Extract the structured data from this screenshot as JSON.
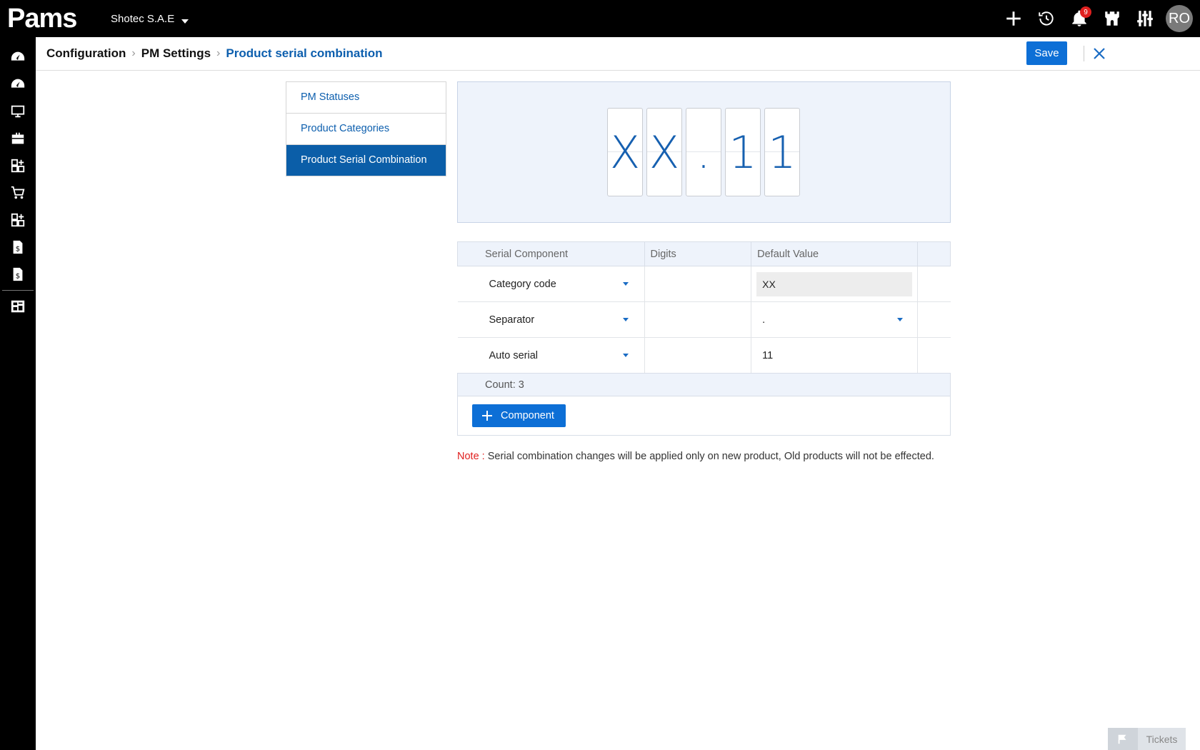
{
  "app": {
    "logo_text": "Pams",
    "company": "Shotec S.A.E",
    "notifications_count": "9",
    "user_initials": "RO"
  },
  "breadcrumb": [
    "Configuration",
    "PM Settings",
    "Product serial combination"
  ],
  "actions": {
    "save_label": "Save"
  },
  "settings_menu": [
    {
      "label": "PM Statuses",
      "active": false
    },
    {
      "label": "Product Categories",
      "active": false
    },
    {
      "label": "Product Serial Combination",
      "active": true
    }
  ],
  "preview": {
    "chars": [
      "X",
      "X",
      ".",
      "1",
      "1"
    ]
  },
  "table": {
    "headers": [
      "Serial Component",
      "Digits",
      "Default Value",
      ""
    ],
    "rows": [
      {
        "component": "Category code",
        "digits": "",
        "default_value": "XX"
      },
      {
        "component": "Separator",
        "digits": "",
        "default_value": "."
      },
      {
        "component": "Auto serial",
        "digits": "",
        "default_value": "11"
      }
    ],
    "count_label": "Count: 3"
  },
  "add_component_label": "Component",
  "note": {
    "label": "Note :",
    "text": "Serial combination changes will be applied only on new product, Old products will not be effected."
  },
  "tickets_label": "Tickets",
  "colors": {
    "accent": "#0d6fd6",
    "active_menu": "#0b5ea8",
    "note_red": "#e0201f"
  }
}
